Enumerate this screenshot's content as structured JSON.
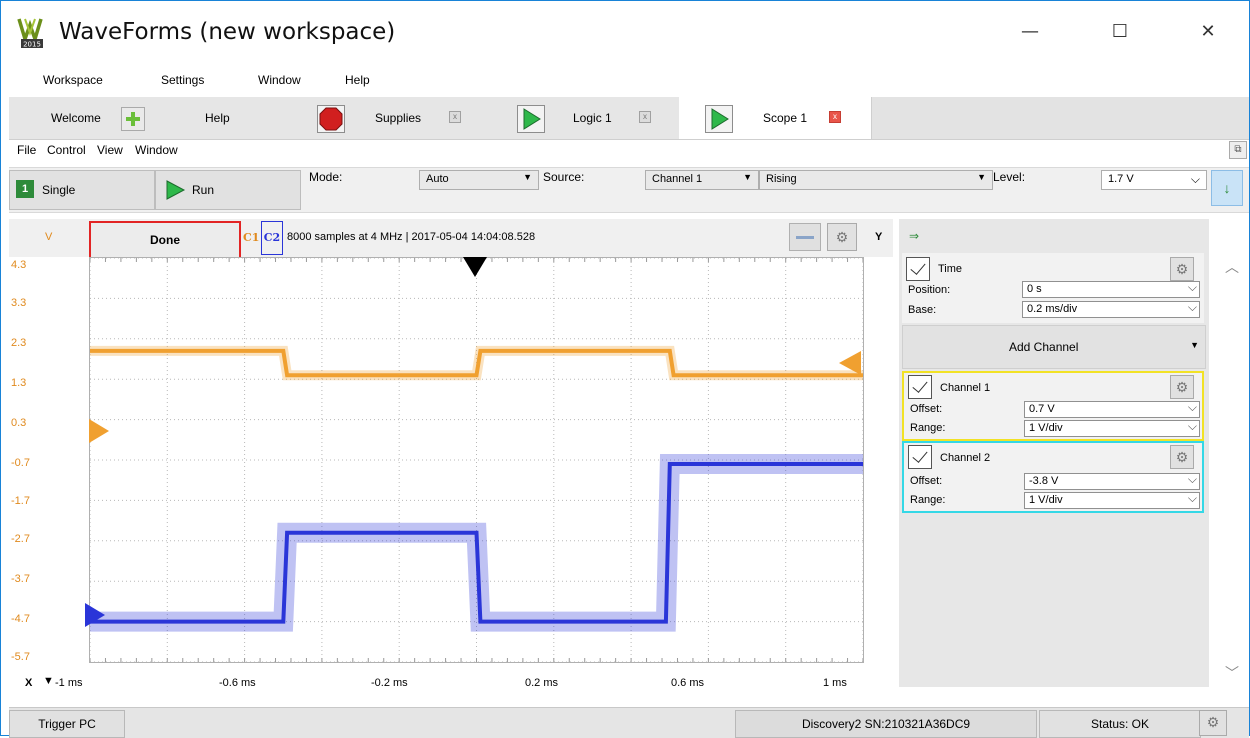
{
  "window": {
    "title": "WaveForms  (new workspace)",
    "minimize": "—",
    "maximize": "☐",
    "close": "✕"
  },
  "app_menu": [
    "Workspace",
    "Settings",
    "Window",
    "Help"
  ],
  "tabs": [
    {
      "label": "Welcome",
      "icon": "plus-icon"
    },
    {
      "label": "Help"
    },
    {
      "label": "Supplies",
      "icon": "stop-icon",
      "closable": true
    },
    {
      "label": "Logic 1",
      "icon": "play-icon",
      "closable": true
    },
    {
      "label": "Scope 1",
      "icon": "play-icon",
      "closable": true,
      "active": true
    }
  ],
  "inner_menu": [
    "File",
    "Control",
    "View",
    "Window"
  ],
  "toolbar": {
    "single_label": "Single",
    "run_label": "Run",
    "mode_label": "Mode:",
    "mode_value": "Auto",
    "source_label": "Source:",
    "source_value": "Channel 1",
    "edge_value": "Rising",
    "level_label": "Level:",
    "level_value": "1.7 V"
  },
  "scope": {
    "unit_label": "V",
    "status": "Done",
    "c1": "C1",
    "c2": "C2",
    "info": "8000 samples at 4 MHz | 2017-05-04 14:04:08.528",
    "y_button": "Y",
    "x_button": "X",
    "y_ticks": [
      "4.3",
      "3.3",
      "2.3",
      "1.3",
      "0.3",
      "-0.7",
      "-1.7",
      "-2.7",
      "-3.7",
      "-4.7",
      "-5.7"
    ],
    "x_ticks": [
      "-1 ms",
      "-0.6 ms",
      "-0.2 ms",
      "0.2 ms",
      "0.6 ms",
      "1 ms"
    ]
  },
  "chart_data": {
    "type": "line",
    "xlabel": "",
    "ylabel": "V",
    "xlim": [
      -1,
      1
    ],
    "ylim": [
      -5.7,
      4.3
    ],
    "x_unit": "ms",
    "series": [
      {
        "name": "C1",
        "color": "#f0a030",
        "x": [
          -1,
          -0.5,
          -0.49,
          0,
          0.01,
          0.5,
          0.51,
          1
        ],
        "values": [
          2.0,
          2.0,
          1.4,
          1.4,
          2.0,
          2.0,
          1.4,
          1.4
        ]
      },
      {
        "name": "C2",
        "color": "#2a35d8",
        "x": [
          -1,
          -0.5,
          -0.49,
          0,
          0.01,
          0.49,
          0.5,
          1
        ],
        "values": [
          -4.7,
          -4.7,
          -2.5,
          -2.5,
          -4.7,
          -4.7,
          -0.8,
          -0.8
        ]
      }
    ],
    "colors": {
      "c1": "#f0a030",
      "c2": "#2a35d8"
    }
  },
  "panel": {
    "time_label": "Time",
    "position_label": "Position:",
    "position_value": "0 s",
    "base_label": "Base:",
    "base_value": "0.2 ms/div",
    "add_channel": "Add Channel",
    "ch1_label": "Channel 1",
    "ch1_offset_label": "Offset:",
    "ch1_offset": "0.7 V",
    "ch1_range_label": "Range:",
    "ch1_range": "1 V/div",
    "ch2_label": "Channel 2",
    "ch2_offset_label": "Offset:",
    "ch2_offset": "-3.8 V",
    "ch2_range_label": "Range:",
    "ch2_range": "1 V/div"
  },
  "status": {
    "trigger_pc": "Trigger PC",
    "device": "Discovery2 SN:210321A36DC9",
    "status": "Status: OK"
  }
}
